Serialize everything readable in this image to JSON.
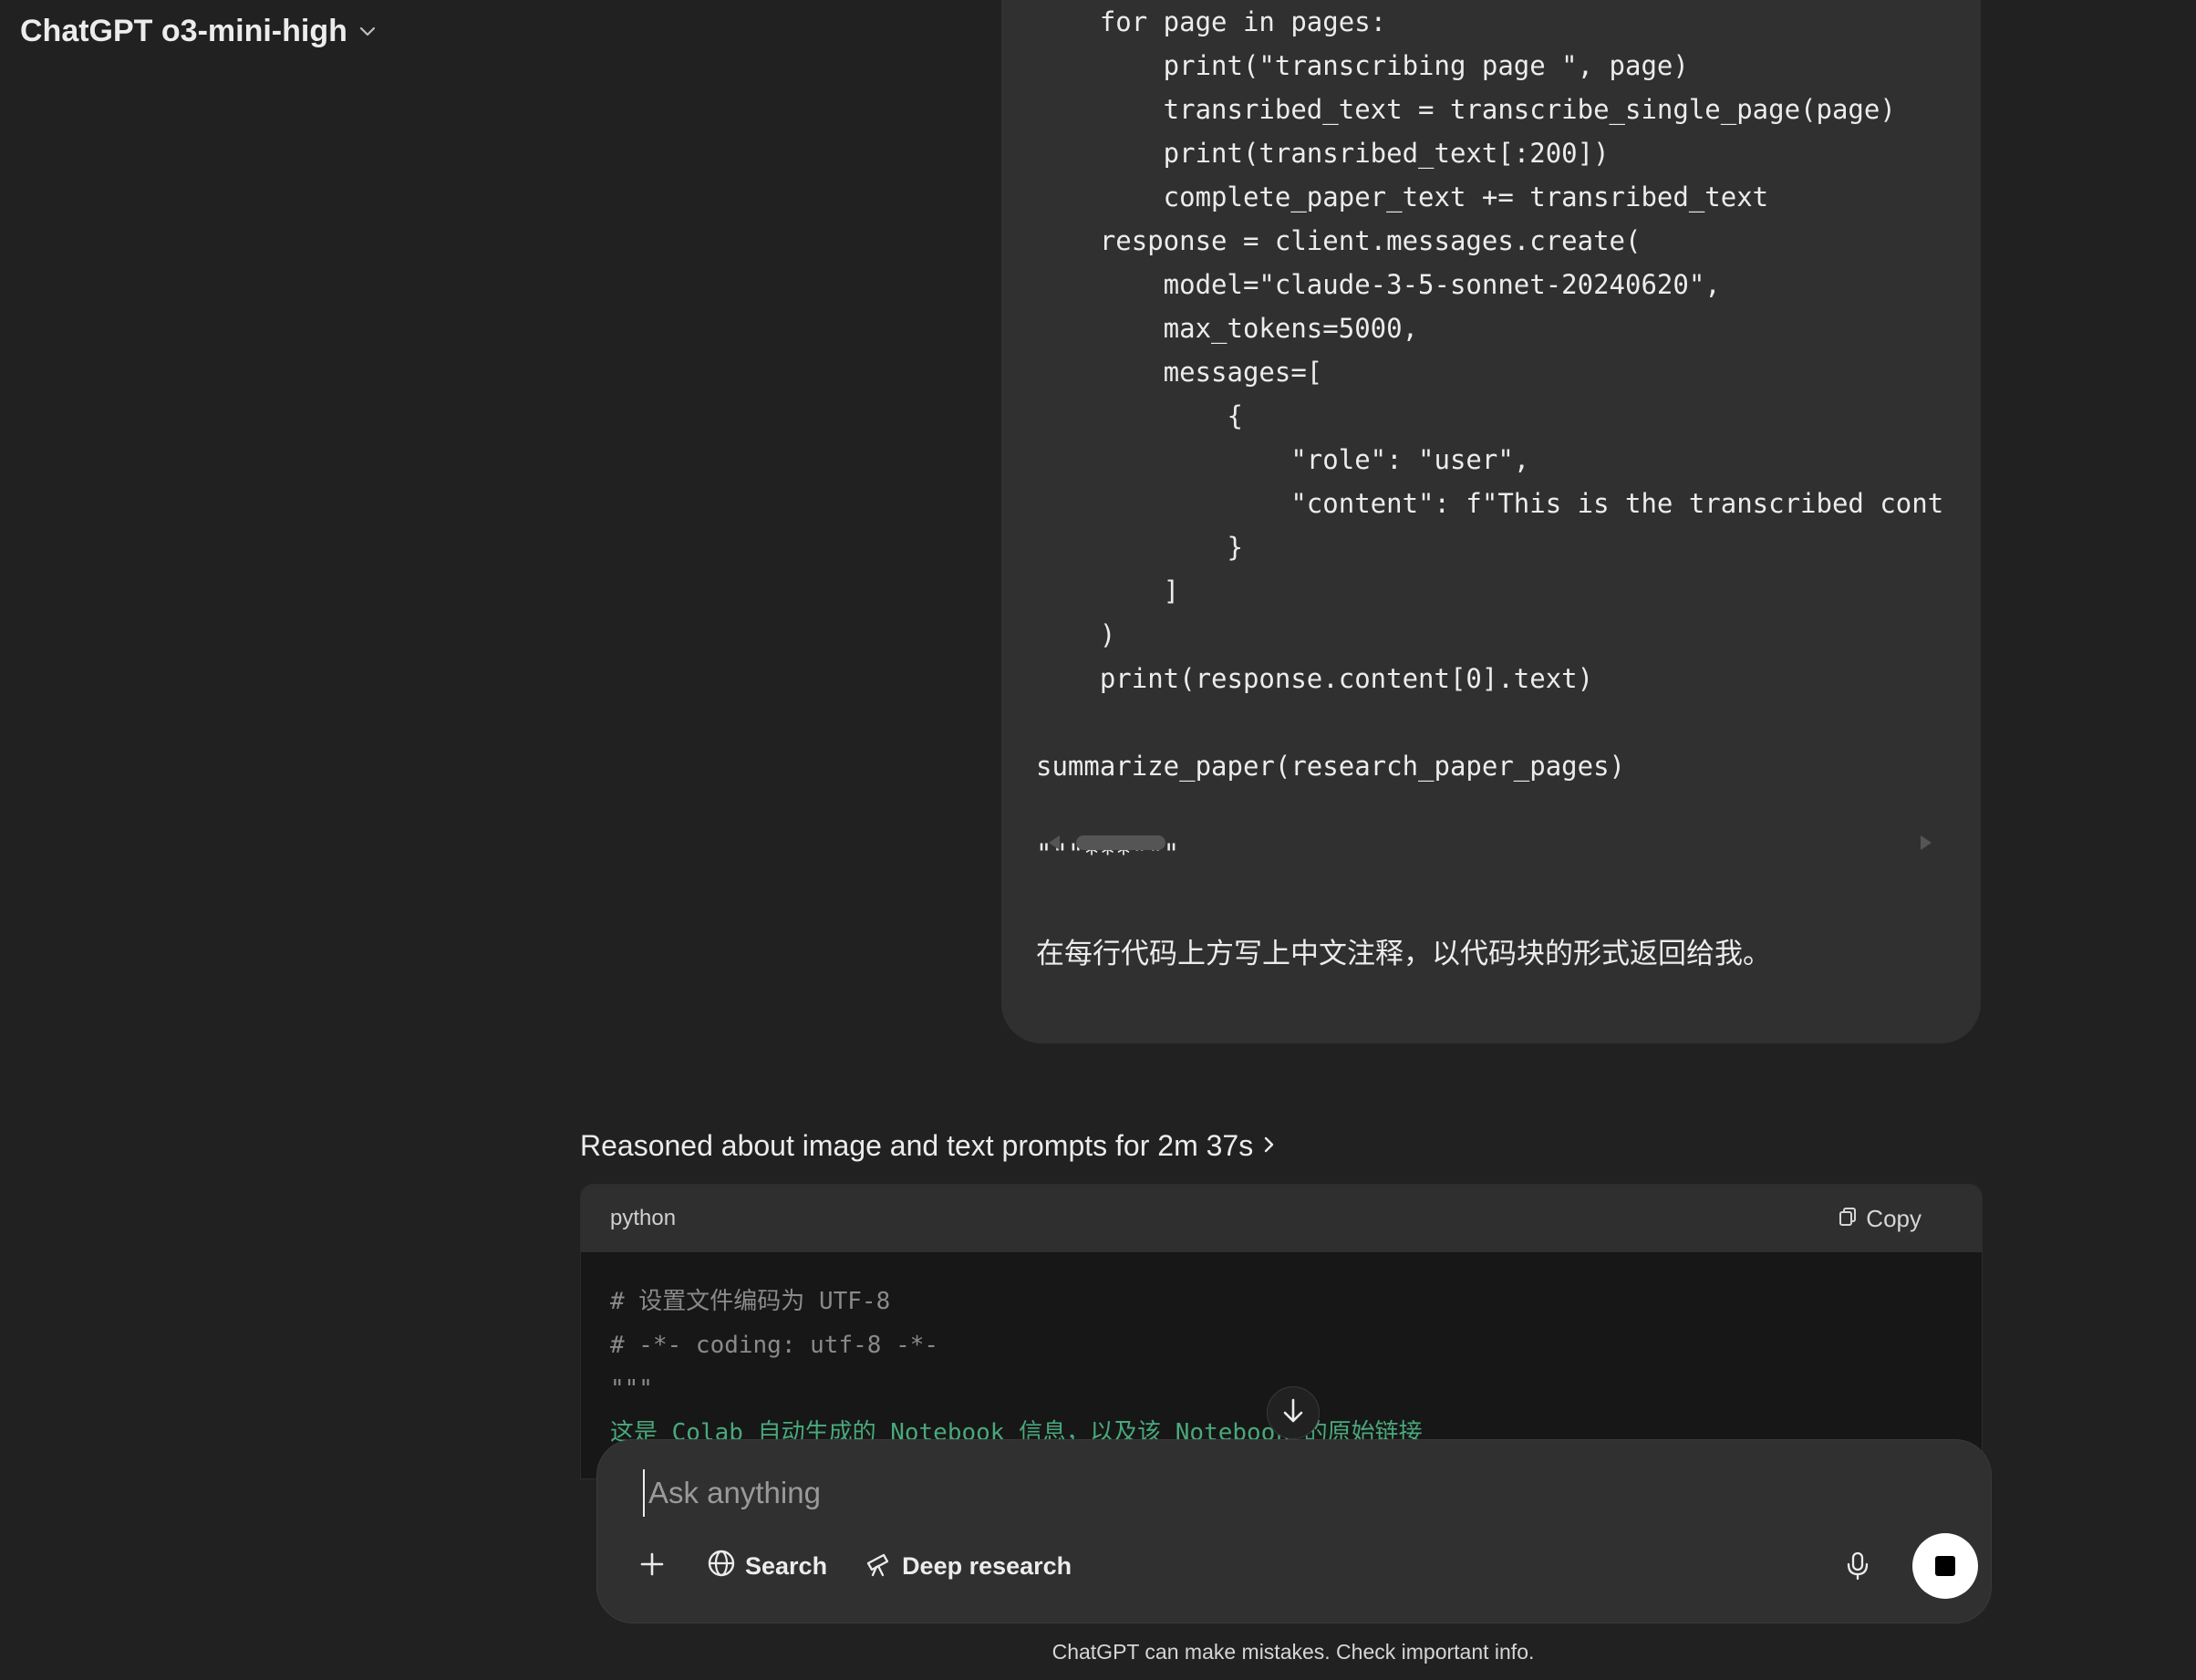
{
  "header": {
    "model_name": "ChatGPT o3-mini-high",
    "chevron_icon": "chevron-down-icon"
  },
  "user_message": {
    "code_lines": [
      "    for page in pages:",
      "        print(\"transcribing page \", page)",
      "        transribed_text = transcribe_single_page(page)",
      "        print(transribed_text[:200])",
      "        complete_paper_text += transribed_text",
      "    response = client.messages.create(",
      "        model=\"claude-3-5-sonnet-20240620\",",
      "        max_tokens=5000,",
      "        messages=[",
      "            {",
      "                \"role\": \"user\",",
      "                \"content\": f\"This is the transcribed cont",
      "            }",
      "        ]",
      "    )",
      "    print(response.content[0].text)",
      "",
      "summarize_paper(research_paper_pages)",
      "",
      "\"\"\"***\"\"\""
    ],
    "instruction": "在每行代码上方写上中文注释，以代码块的形式返回给我。"
  },
  "assistant": {
    "reasoning_label": "Reasoned about image and text prompts for 2m 37s",
    "code_block": {
      "language": "python",
      "copy_label": "Copy",
      "lines": [
        {
          "text": "# 设置文件编码为 UTF-8",
          "kind": "comment"
        },
        {
          "text": "# -*- coding: utf-8 -*-",
          "kind": "comment"
        },
        {
          "text": "\"\"\"",
          "kind": "comment"
        },
        {
          "text": "这是 Colab 自动生成的 Notebook 信息，以及该 Notebook 的原始链接",
          "kind": "string"
        }
      ]
    }
  },
  "composer": {
    "placeholder": "Ask anything",
    "value": "",
    "tools": {
      "search_label": "Search",
      "deep_research_label": "Deep research"
    }
  },
  "footer": {
    "disclaimer": "ChatGPT can make mistakes. Check important info."
  }
}
